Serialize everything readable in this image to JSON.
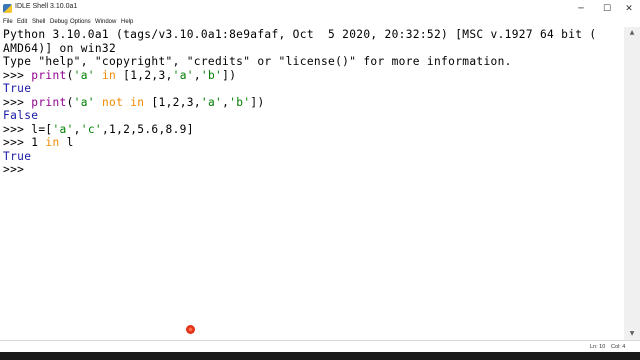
{
  "window": {
    "title": "IDLE Shell 3.10.0a1",
    "controls": {
      "minimize": "─",
      "maximize": "☐",
      "close": "✕"
    }
  },
  "menu": {
    "items": [
      "File",
      "Edit",
      "Shell",
      "Debug",
      "Options",
      "Window",
      "Help"
    ]
  },
  "shell": {
    "banner_line1": "Python 3.10.0a1 (tags/v3.10.0a1:8e9afaf, Oct  5 2020, 20:32:52) [MSC v.1927 64 bit (",
    "banner_line2": "AMD64)] on win32",
    "info_line": "Type \"help\", \"copyright\", \"credits\" or \"license()\" for more information.",
    "prompt": ">>> ",
    "cmd1": {
      "func": "print",
      "open": "(",
      "str1": "'a'",
      "kw": "in",
      "list_start": "[1,2,3,",
      "str2": "'a'",
      "comma": ",",
      "str3": "'b'",
      "close": "])"
    },
    "out1": "True",
    "cmd2": {
      "func": "print",
      "open": "(",
      "str1": "'a'",
      "kw1": "not",
      "kw2": "in",
      "list_start": "[1,2,3,",
      "str2": "'a'",
      "comma": ",",
      "str3": "'b'",
      "close": "])"
    },
    "out2": "False",
    "cmd3": {
      "prefix": "l=[",
      "str1": "'a'",
      "comma": ",",
      "str2": "'c'",
      "rest": ",1,2,5.6,8.9]"
    },
    "cmd4": {
      "pre": "1 ",
      "kw": "in",
      "post": " l"
    },
    "out3": "True",
    "final_prompt": ">>>"
  },
  "scrollbar": {
    "up_icon": "▲",
    "down_icon": "▼"
  },
  "status": {
    "line": "Ln: 10",
    "col": "Col: 4"
  },
  "colors": {
    "keyword": "#f28a00",
    "builtin": "#900090",
    "string": "#008000",
    "output": "#1a1aa6"
  }
}
